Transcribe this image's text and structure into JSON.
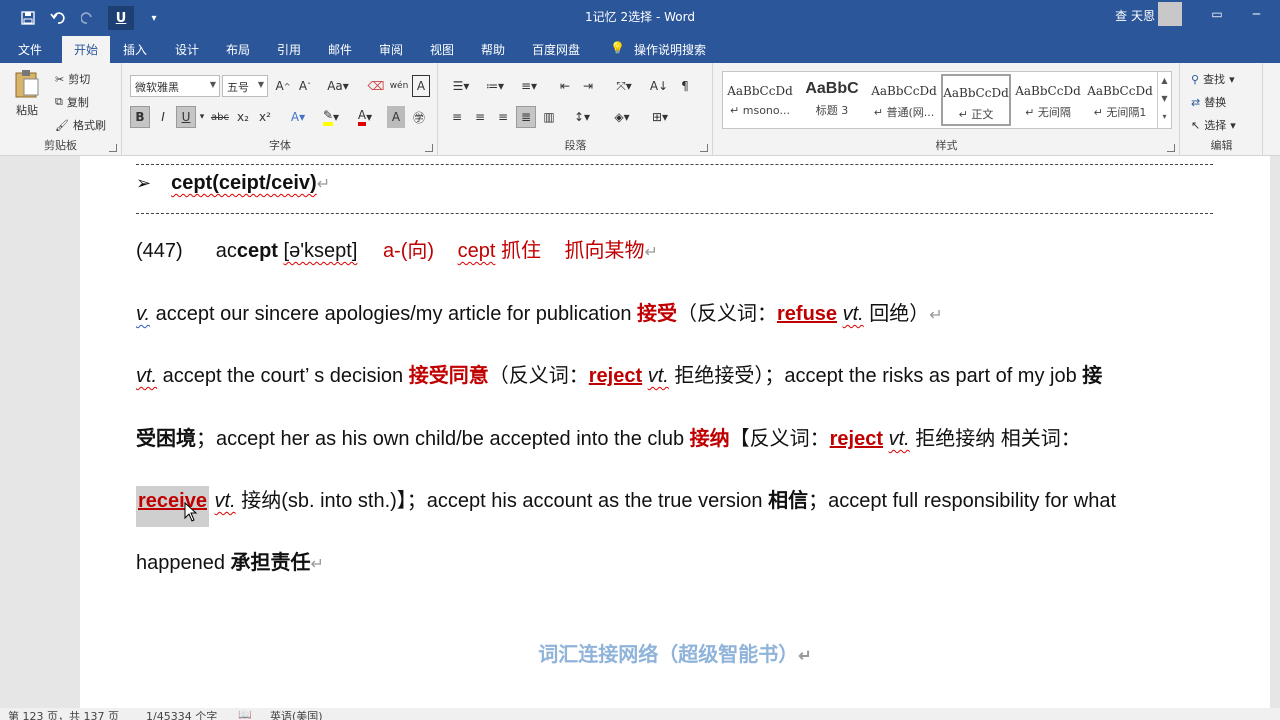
{
  "window": {
    "doc_title": "1记忆 2选择 - Word",
    "user_name": "查 天恩",
    "ribbon_display_icon": "ribbon-display-icon",
    "minimize_glyph": "─"
  },
  "qat": {
    "save_icon": "save-icon",
    "undo_icon": "undo-icon",
    "redo_icon": "redo-icon",
    "underline_label": "U",
    "customize_icon": "customize-icon"
  },
  "tabs": [
    "文件",
    "开始",
    "插入",
    "设计",
    "布局",
    "引用",
    "邮件",
    "审阅",
    "视图",
    "帮助",
    "百度网盘"
  ],
  "tell_me": "操作说明搜索",
  "ribbon": {
    "clipboard": {
      "paste": "粘贴",
      "cut": "剪切",
      "copy": "复制",
      "format_painter": "格式刷",
      "label": "剪贴板"
    },
    "font": {
      "font_name": "微软雅黑",
      "font_size": "五号",
      "label": "字体",
      "bold": "B",
      "italic": "I",
      "underline": "U",
      "strike": "abc",
      "sub": "x₂",
      "sup": "x²"
    },
    "paragraph": {
      "label": "段落"
    },
    "styles": {
      "label": "样式",
      "items": [
        {
          "preview": "AaBbCcDd",
          "name": "↵ msono..."
        },
        {
          "preview": "AaBbC",
          "name": "标题 3"
        },
        {
          "preview": "AaBbCcDd",
          "name": "↵ 普通(网..."
        },
        {
          "preview": "AaBbCcDd",
          "name": "↵ 正文"
        },
        {
          "preview": "AaBbCcDd",
          "name": "↵ 无间隔"
        },
        {
          "preview": "AaBbCcDd",
          "name": "↵ 无间隔1"
        }
      ]
    },
    "editing": {
      "find": "查找",
      "replace": "替换",
      "select": "选择",
      "label": "编辑"
    }
  },
  "document": {
    "heading_bullet": "➢",
    "heading": "cept(ceipt/ceiv)",
    "entry_number": "(447)",
    "word_prefix": "ac",
    "word_root": "cept",
    "phonetic": "[ə'ksept]",
    "prefix_gloss": "a-(向)",
    "root_gloss_word": "cept",
    "root_gloss": "抓住",
    "meaning_gloss": "抓向某物",
    "line1": {
      "pos": "v.",
      "text": " accept our sincere apologies/my article for publication ",
      "meaning": "接受",
      "open": "（反义词：",
      "ant": "refuse",
      "ant_pos": "vt.",
      "ant_mean": " 回绝）"
    },
    "line2": {
      "pos": "vt.",
      "text1": " accept the court’ s decision ",
      "meaning1": "接受同意",
      "open": "（反义词：",
      "ant": "reject",
      "ant_pos": "vt.",
      "ant_mean": " 拒绝接受）；accept the risks as part of my job ",
      "meaning2": "接"
    },
    "line3": {
      "meaning2_cont": "受困境",
      "text": "；accept her as his own child/be accepted into the club ",
      "meaning3": "接纳",
      "open": "【反义词：",
      "ant": "reject",
      "ant_pos": "vt.",
      "ant_mean": " 拒绝接纳  相关词："
    },
    "line4": {
      "rel": "receive",
      "rel_pos": "vt.",
      "rel_mean": " 接纳(sb. into sth.)】；accept his account as the true version ",
      "meaning4": "相信",
      "text": "；accept full responsibility for what"
    },
    "line5": {
      "text": "happened ",
      "meaning5": "承担责任"
    },
    "brand": "词汇连接网络（超级智能书）",
    "para_mark": "↵"
  },
  "status": {
    "page": "第 123 页，共 137 页",
    "words": "1/45334 个字",
    "language": "英语(美国)"
  }
}
